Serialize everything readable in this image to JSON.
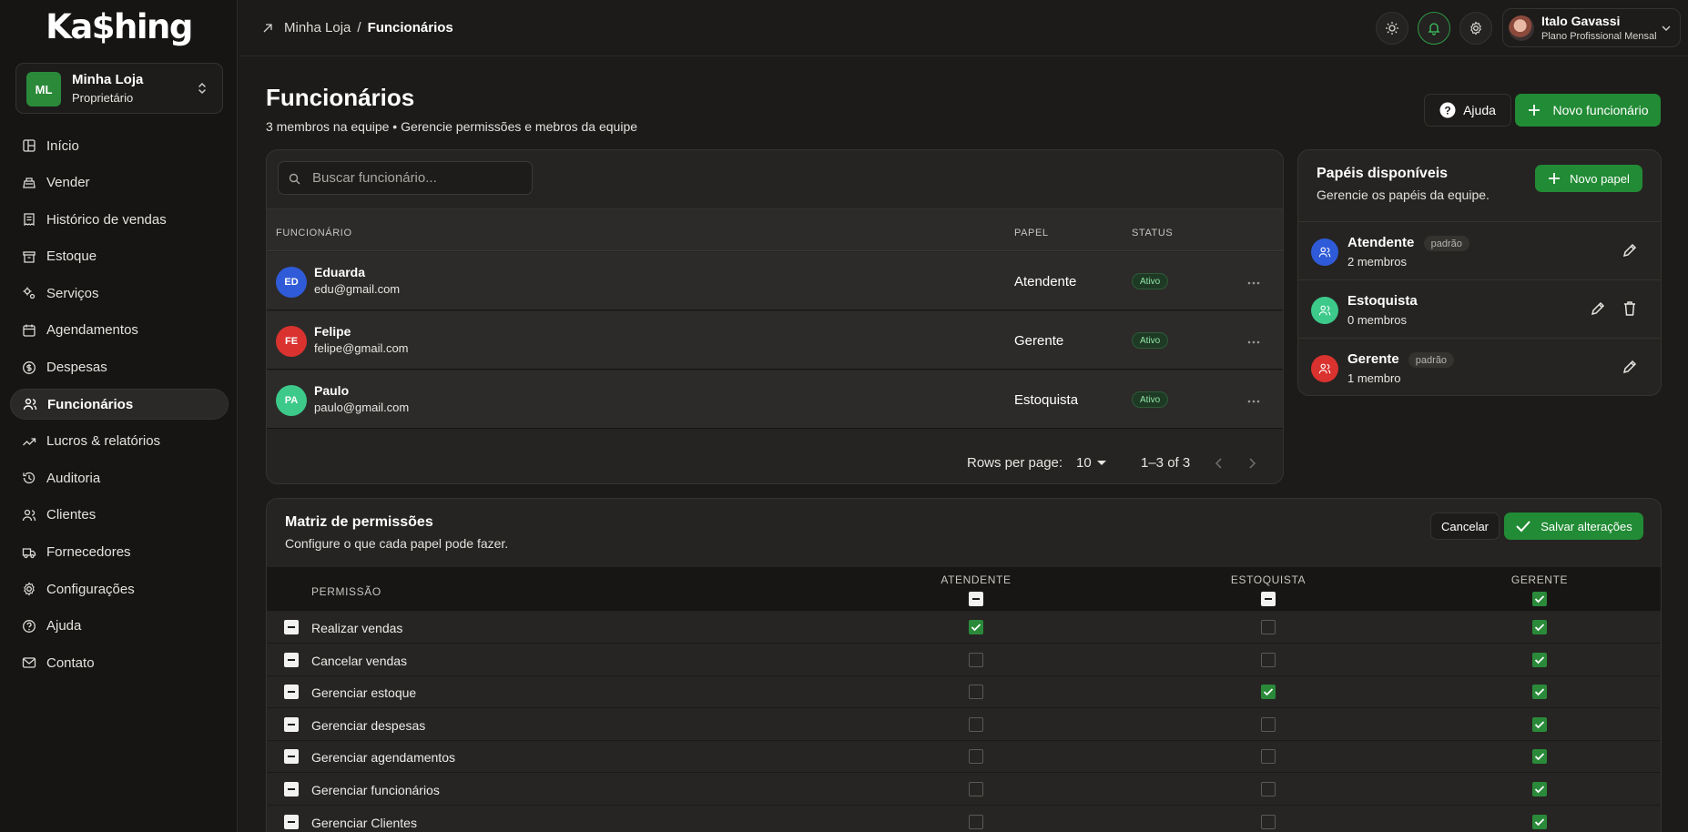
{
  "brand": {
    "logo": "Ka$hing"
  },
  "store": {
    "initials": "ML",
    "name": "Minha Loja",
    "role": "Proprietário"
  },
  "nav": [
    {
      "label": "Início",
      "icon": "dashboard-icon",
      "active": false
    },
    {
      "label": "Vender",
      "icon": "register-icon",
      "active": false
    },
    {
      "label": "Histórico de vendas",
      "icon": "receipt-icon",
      "active": false
    },
    {
      "label": "Estoque",
      "icon": "box-icon",
      "active": false
    },
    {
      "label": "Serviços",
      "icon": "gears-icon",
      "active": false
    },
    {
      "label": "Agendamentos",
      "icon": "calendar-icon",
      "active": false
    },
    {
      "label": "Despesas",
      "icon": "dollar-icon",
      "active": false
    },
    {
      "label": "Funcionários",
      "icon": "users-icon",
      "active": true
    },
    {
      "label": "Lucros & relatórios",
      "icon": "trend-icon",
      "active": false
    },
    {
      "label": "Auditoria",
      "icon": "history-icon",
      "active": false
    },
    {
      "label": "Clientes",
      "icon": "clients-icon",
      "active": false
    },
    {
      "label": "Fornecedores",
      "icon": "truck-icon",
      "active": false
    },
    {
      "label": "Configurações",
      "icon": "settings-icon",
      "active": false
    },
    {
      "label": "Ajuda",
      "icon": "help-icon",
      "active": false
    },
    {
      "label": "Contato",
      "icon": "mail-icon",
      "active": false
    }
  ],
  "breadcrumb": {
    "parent": "Minha Loja",
    "separator": "/",
    "current": "Funcionários"
  },
  "user": {
    "name": "Italo Gavassi",
    "plan": "Plano Profissional Mensal"
  },
  "header": {
    "title": "Funcionários",
    "subtitle": "3 membros na equipe • Gerencie permissões e mebros da equipe",
    "help_label": "Ajuda",
    "new_employee_label": "Novo funcionário"
  },
  "employees": {
    "search_placeholder": "Buscar funcionário...",
    "columns": {
      "employee": "FUNCIONÁRIO",
      "role": "PAPEL",
      "status": "STATUS"
    },
    "rows": [
      {
        "initials": "ED",
        "name": "Eduarda",
        "email": "edu@gmail.com",
        "role": "Atendente",
        "status": "Ativo",
        "color": "#2f5bd8"
      },
      {
        "initials": "FE",
        "name": "Felipe",
        "email": "felipe@gmail.com",
        "role": "Gerente",
        "status": "Ativo",
        "color": "#d9322f"
      },
      {
        "initials": "PA",
        "name": "Paulo",
        "email": "paulo@gmail.com",
        "role": "Estoquista",
        "status": "Ativo",
        "color": "#3cc98a"
      }
    ],
    "pagination": {
      "rows_per_page_label": "Rows per page:",
      "rows_per_page": "10",
      "range": "1–3 of 3"
    }
  },
  "roles": {
    "title": "Papéis disponíveis",
    "subtitle": "Gerencie os papéis da equipe.",
    "new_role_label": "Novo papel",
    "items": [
      {
        "name": "Atendente",
        "tag": "padrão",
        "count": "2 membros",
        "color": "#2f5bd8",
        "deletable": false
      },
      {
        "name": "Estoquista",
        "tag": "",
        "count": "0 membros",
        "color": "#3cc98a",
        "deletable": true
      },
      {
        "name": "Gerente",
        "tag": "padrão",
        "count": "1 membro",
        "color": "#d9322f",
        "deletable": false
      }
    ]
  },
  "matrix": {
    "title": "Matriz de permissões",
    "subtitle": "Configure o que cada papel pode fazer.",
    "cancel_label": "Cancelar",
    "save_label": "Salvar alterações",
    "permission_header": "PERMISSÃO",
    "roles": [
      {
        "name": "ATENDENTE",
        "header_state": "indeterminate"
      },
      {
        "name": "ESTOQUISTA",
        "header_state": "indeterminate"
      },
      {
        "name": "GERENTE",
        "header_state": "checked"
      }
    ],
    "permissions": [
      {
        "label": "Realizar vendas",
        "values": [
          true,
          false,
          true
        ]
      },
      {
        "label": "Cancelar vendas",
        "values": [
          false,
          false,
          true
        ]
      },
      {
        "label": "Gerenciar estoque",
        "values": [
          false,
          true,
          true
        ]
      },
      {
        "label": "Gerenciar despesas",
        "values": [
          false,
          false,
          true
        ]
      },
      {
        "label": "Gerenciar agendamentos",
        "values": [
          false,
          false,
          true
        ]
      },
      {
        "label": "Gerenciar funcionários",
        "values": [
          false,
          false,
          true
        ]
      },
      {
        "label": "Gerenciar Clientes",
        "values": [
          false,
          false,
          true
        ]
      }
    ]
  },
  "colors": {
    "accent": "#228b35",
    "background": "#1c1b19",
    "sidebar": "#161513",
    "card": "#252422"
  }
}
